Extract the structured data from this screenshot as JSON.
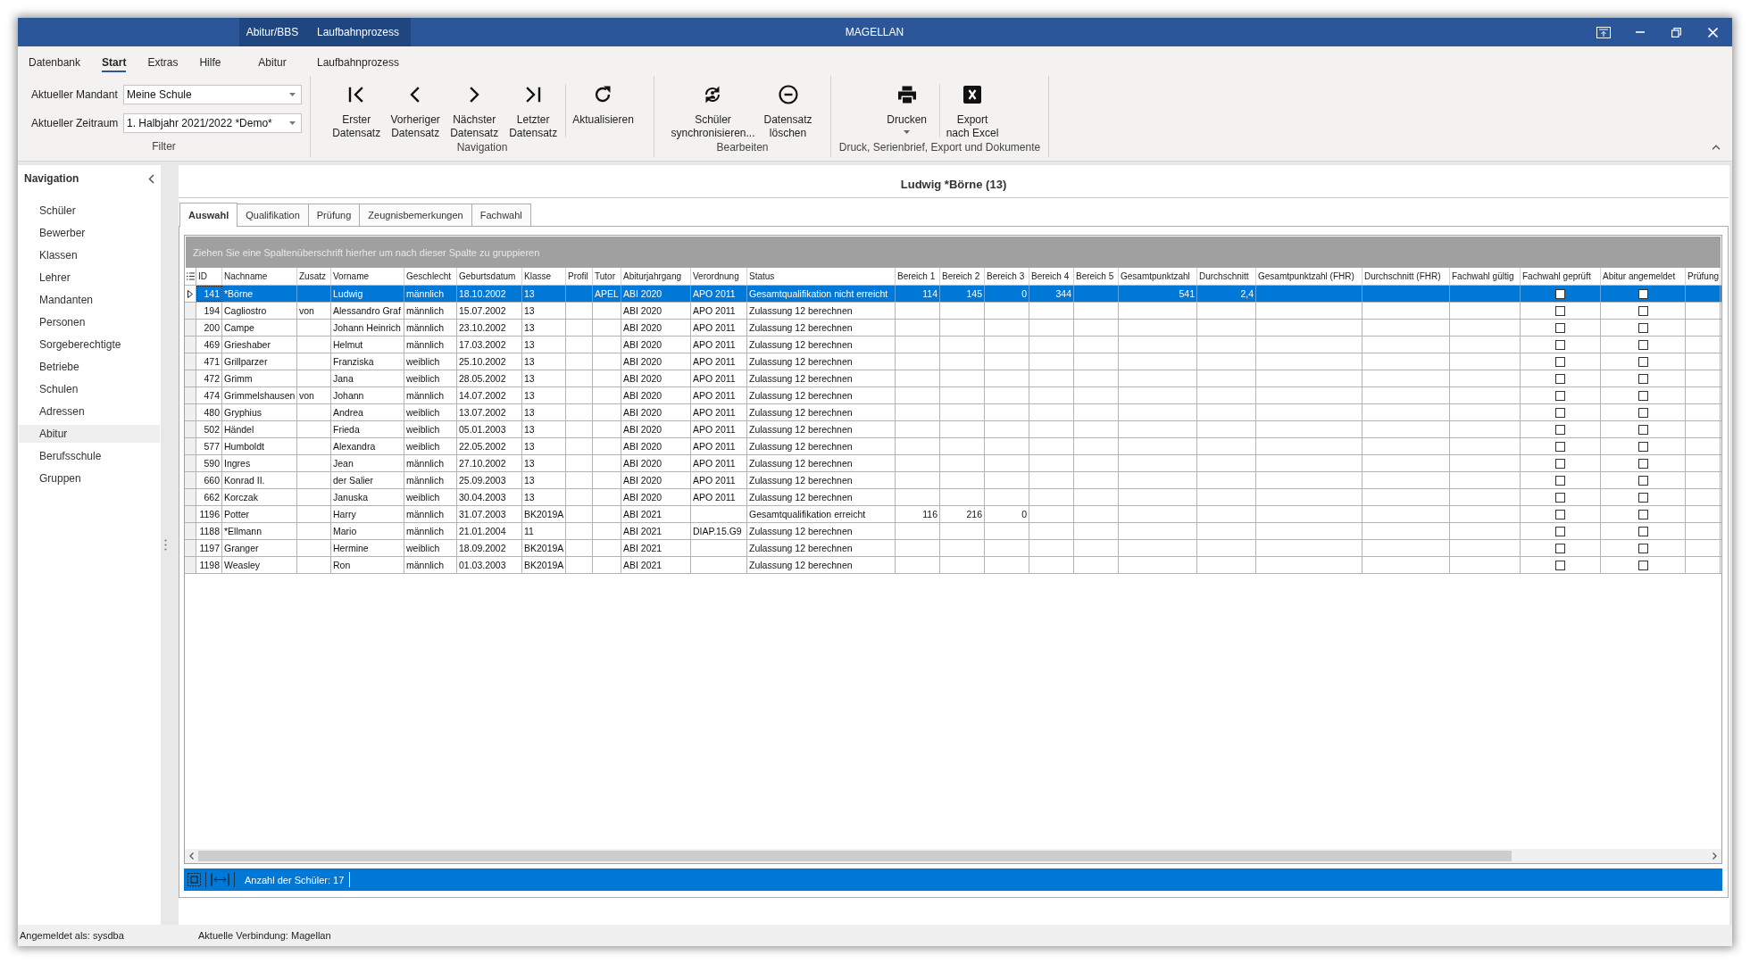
{
  "window": {
    "title": "MAGELLAN"
  },
  "ribbon_tabs": [
    {
      "label": "Datenbank",
      "selected": false
    },
    {
      "label": "Start",
      "selected": true
    },
    {
      "label": "Extras",
      "selected": false
    },
    {
      "label": "Hilfe",
      "selected": false
    }
  ],
  "context_tab_groups": [
    {
      "label": "Abitur/BBS",
      "tabs": [
        {
          "label": "Abitur",
          "selected": false
        }
      ]
    },
    {
      "label": "Laufbahnprozess",
      "tabs": [
        {
          "label": "Laufbahnprozess",
          "selected": false
        }
      ]
    }
  ],
  "ribbon": {
    "filter": {
      "label": "Filter",
      "fields": [
        {
          "label": "Aktueller Mandant",
          "value": "Meine Schule"
        },
        {
          "label": "Aktueller Zeitraum",
          "value": "1. Halbjahr 2021/2022 *Demo*"
        }
      ]
    },
    "groups": [
      {
        "label": "Navigation",
        "sets": [
          [
            {
              "label": "Erster\nDatensatz"
            },
            {
              "label": "Vorheriger\nDatensatz"
            },
            {
              "label": "Nächster\nDatensatz"
            },
            {
              "label": "Letzter\nDatensatz"
            }
          ],
          [
            {
              "label": "Aktualisieren"
            }
          ]
        ]
      },
      {
        "label": "Bearbeiten",
        "sets": [
          [
            {
              "label": "Schüler\nsynchronisieren..."
            },
            {
              "label": "Datensatz\nlöschen"
            }
          ]
        ]
      },
      {
        "label": "Druck, Serienbrief, Export und Dokumente",
        "sets": [
          [
            {
              "label": "Drucken",
              "dropdown": true
            }
          ],
          [
            {
              "label": "Export\nnach Excel"
            }
          ]
        ]
      }
    ]
  },
  "sidebar": {
    "title": "Navigation",
    "items": [
      {
        "label": "Schüler",
        "selected": false
      },
      {
        "label": "Bewerber",
        "selected": false
      },
      {
        "label": "Klassen",
        "selected": false
      },
      {
        "label": "Lehrer",
        "selected": false
      },
      {
        "label": "Mandanten",
        "selected": false
      },
      {
        "label": "Personen",
        "selected": false
      },
      {
        "label": "Sorgeberechtigte",
        "selected": false
      },
      {
        "label": "Betriebe",
        "selected": false
      },
      {
        "label": "Schulen",
        "selected": false
      },
      {
        "label": "Adressen",
        "selected": false
      },
      {
        "label": "Abitur",
        "selected": true
      },
      {
        "label": "Berufsschule",
        "selected": false
      },
      {
        "label": "Gruppen",
        "selected": false
      }
    ]
  },
  "record_title": "Ludwig *Börne (13)",
  "detail_tabs": [
    {
      "label": "Auswahl",
      "selected": true
    },
    {
      "label": "Qualifikation",
      "selected": false
    },
    {
      "label": "Prüfung",
      "selected": false
    },
    {
      "label": "Zeugnisbemerkungen",
      "selected": false
    },
    {
      "label": "Fachwahl",
      "selected": false
    }
  ],
  "grid": {
    "group_panel_hint": "Ziehen Sie eine Spaltenüberschrift hierher um nach dieser Spalte zu gruppieren",
    "columns": [
      {
        "label": "ID",
        "kind": "number"
      },
      {
        "label": "Nachname",
        "kind": "text"
      },
      {
        "label": "Zusatz",
        "kind": "text"
      },
      {
        "label": "Vorname",
        "kind": "text"
      },
      {
        "label": "Geschlecht",
        "kind": "text"
      },
      {
        "label": "Geburtsdatum",
        "kind": "text"
      },
      {
        "label": "Klasse",
        "kind": "text"
      },
      {
        "label": "Profil",
        "kind": "text"
      },
      {
        "label": "Tutor",
        "kind": "text"
      },
      {
        "label": "Abiturjahrgang",
        "kind": "text"
      },
      {
        "label": "Verordnung",
        "kind": "text"
      },
      {
        "label": "Status",
        "kind": "text"
      },
      {
        "label": "Bereich 1",
        "kind": "number"
      },
      {
        "label": "Bereich 2",
        "kind": "number"
      },
      {
        "label": "Bereich 3",
        "kind": "number"
      },
      {
        "label": "Bereich 4",
        "kind": "number"
      },
      {
        "label": "Bereich 5",
        "kind": "number"
      },
      {
        "label": "Gesamtpunktzahl",
        "kind": "number"
      },
      {
        "label": "Durchschnitt",
        "kind": "number"
      },
      {
        "label": "Gesamtpunktzahl (FHR)",
        "kind": "number"
      },
      {
        "label": "Durchschnitt (FHR)",
        "kind": "number"
      },
      {
        "label": "Fachwahl gültig",
        "kind": "text"
      },
      {
        "label": "Fachwahl geprüft",
        "kind": "checkbox"
      },
      {
        "label": "Abitur angemeldet",
        "kind": "checkbox"
      },
      {
        "label": "Prüfung",
        "kind": "text"
      }
    ],
    "rows": [
      {
        "selected": true,
        "cells": [
          "141",
          "*Börne",
          null,
          "Ludwig",
          "männlich",
          "18.10.2002",
          "13",
          null,
          "APEL",
          "ABI 2020",
          "APO 2011",
          "Gesamtqualifikation nicht erreicht",
          "114",
          "145",
          "0",
          "344",
          null,
          "541",
          "2,4",
          null,
          null,
          null,
          {
            "checked": false
          },
          {
            "checked": false
          },
          null
        ]
      },
      {
        "selected": false,
        "cells": [
          "194",
          "Cagliostro",
          "von",
          "Alessandro Graf",
          "männlich",
          "15.07.2002",
          "13",
          null,
          null,
          "ABI 2020",
          "APO 2011",
          "Zulassung 12 berechnen",
          null,
          null,
          null,
          null,
          null,
          null,
          null,
          null,
          null,
          null,
          {
            "checked": false
          },
          {
            "checked": false
          },
          null
        ]
      },
      {
        "selected": false,
        "cells": [
          "200",
          "Campe",
          null,
          "Johann Heinrich",
          "männlich",
          "23.10.2002",
          "13",
          null,
          null,
          "ABI 2020",
          "APO 2011",
          "Zulassung 12 berechnen",
          null,
          null,
          null,
          null,
          null,
          null,
          null,
          null,
          null,
          null,
          {
            "checked": false
          },
          {
            "checked": false
          },
          null
        ]
      },
      {
        "selected": false,
        "cells": [
          "469",
          "Grieshaber",
          null,
          "Helmut",
          "männlich",
          "17.03.2002",
          "13",
          null,
          null,
          "ABI 2020",
          "APO 2011",
          "Zulassung 12 berechnen",
          null,
          null,
          null,
          null,
          null,
          null,
          null,
          null,
          null,
          null,
          {
            "checked": false
          },
          {
            "checked": false
          },
          null
        ]
      },
      {
        "selected": false,
        "cells": [
          "471",
          "Grillparzer",
          null,
          "Franziska",
          "weiblich",
          "25.10.2002",
          "13",
          null,
          null,
          "ABI 2020",
          "APO 2011",
          "Zulassung 12 berechnen",
          null,
          null,
          null,
          null,
          null,
          null,
          null,
          null,
          null,
          null,
          {
            "checked": false
          },
          {
            "checked": false
          },
          null
        ]
      },
      {
        "selected": false,
        "cells": [
          "472",
          "Grimm",
          null,
          "Jana",
          "weiblich",
          "28.05.2002",
          "13",
          null,
          null,
          "ABI 2020",
          "APO 2011",
          "Zulassung 12 berechnen",
          null,
          null,
          null,
          null,
          null,
          null,
          null,
          null,
          null,
          null,
          {
            "checked": false
          },
          {
            "checked": false
          },
          null
        ]
      },
      {
        "selected": false,
        "cells": [
          "474",
          "Grimmelshausen",
          "von",
          "Johann",
          "männlich",
          "14.07.2002",
          "13",
          null,
          null,
          "ABI 2020",
          "APO 2011",
          "Zulassung 12 berechnen",
          null,
          null,
          null,
          null,
          null,
          null,
          null,
          null,
          null,
          null,
          {
            "checked": false
          },
          {
            "checked": false
          },
          null
        ]
      },
      {
        "selected": false,
        "cells": [
          "480",
          "Gryphius",
          null,
          "Andrea",
          "weiblich",
          "13.07.2002",
          "13",
          null,
          null,
          "ABI 2020",
          "APO 2011",
          "Zulassung 12 berechnen",
          null,
          null,
          null,
          null,
          null,
          null,
          null,
          null,
          null,
          null,
          {
            "checked": false
          },
          {
            "checked": false
          },
          null
        ]
      },
      {
        "selected": false,
        "cells": [
          "502",
          "Händel",
          null,
          "Frieda",
          "weiblich",
          "05.01.2003",
          "13",
          null,
          null,
          "ABI 2020",
          "APO 2011",
          "Zulassung 12 berechnen",
          null,
          null,
          null,
          null,
          null,
          null,
          null,
          null,
          null,
          null,
          {
            "checked": false
          },
          {
            "checked": false
          },
          null
        ]
      },
      {
        "selected": false,
        "cells": [
          "577",
          "Humboldt",
          null,
          "Alexandra",
          "weiblich",
          "22.05.2002",
          "13",
          null,
          null,
          "ABI 2020",
          "APO 2011",
          "Zulassung 12 berechnen",
          null,
          null,
          null,
          null,
          null,
          null,
          null,
          null,
          null,
          null,
          {
            "checked": false
          },
          {
            "checked": false
          },
          null
        ]
      },
      {
        "selected": false,
        "cells": [
          "590",
          "Ingres",
          null,
          "Jean",
          "männlich",
          "27.10.2002",
          "13",
          null,
          null,
          "ABI 2020",
          "APO 2011",
          "Zulassung 12 berechnen",
          null,
          null,
          null,
          null,
          null,
          null,
          null,
          null,
          null,
          null,
          {
            "checked": false
          },
          {
            "checked": false
          },
          null
        ]
      },
      {
        "selected": false,
        "cells": [
          "660",
          "Konrad II.",
          null,
          "der Salier",
          "männlich",
          "25.09.2003",
          "13",
          null,
          null,
          "ABI 2020",
          "APO 2011",
          "Zulassung 12 berechnen",
          null,
          null,
          null,
          null,
          null,
          null,
          null,
          null,
          null,
          null,
          {
            "checked": false
          },
          {
            "checked": false
          },
          null
        ]
      },
      {
        "selected": false,
        "cells": [
          "662",
          "Korczak",
          null,
          "Januska",
          "weiblich",
          "30.04.2003",
          "13",
          null,
          null,
          "ABI 2020",
          "APO 2011",
          "Zulassung 12 berechnen",
          null,
          null,
          null,
          null,
          null,
          null,
          null,
          null,
          null,
          null,
          {
            "checked": false
          },
          {
            "checked": false
          },
          null
        ]
      },
      {
        "selected": false,
        "cells": [
          "1196",
          "Potter",
          null,
          "Harry",
          "männlich",
          "31.07.2003",
          "BK2019A",
          null,
          null,
          "ABI 2021",
          null,
          "Gesamtqualifikation erreicht",
          "116",
          "216",
          "0",
          null,
          null,
          null,
          null,
          null,
          null,
          null,
          {
            "checked": false
          },
          {
            "checked": false
          },
          null
        ]
      },
      {
        "selected": false,
        "cells": [
          "1188",
          "*Ellmann",
          null,
          "Mario",
          "männlich",
          "21.01.2004",
          "11",
          null,
          null,
          "ABI 2021",
          "DIAP.15.G9",
          "Zulassung 12 berechnen",
          null,
          null,
          null,
          null,
          null,
          null,
          null,
          null,
          null,
          null,
          {
            "checked": false
          },
          {
            "checked": false
          },
          null
        ]
      },
      {
        "selected": false,
        "cells": [
          "1197",
          "Granger",
          null,
          "Hermine",
          "weiblich",
          "18.09.2002",
          "BK2019A",
          null,
          null,
          "ABI 2021",
          null,
          "Zulassung 12 berechnen",
          null,
          null,
          null,
          null,
          null,
          null,
          null,
          null,
          null,
          null,
          {
            "checked": false
          },
          {
            "checked": false
          },
          null
        ]
      },
      {
        "selected": false,
        "cells": [
          "1198",
          "Weasley",
          null,
          "Ron",
          "männlich",
          "01.03.2003",
          "BK2019A",
          null,
          null,
          "ABI 2021",
          null,
          "Zulassung 12 berechnen",
          null,
          null,
          null,
          null,
          null,
          null,
          null,
          null,
          null,
          null,
          {
            "checked": false
          },
          {
            "checked": false
          },
          null
        ]
      }
    ],
    "footer": {
      "record_count": "Anzahl der Schüler: 17"
    }
  },
  "status_bar": {
    "items": [
      "Angemeldet als: sysdba",
      "Aktuelle Verbindung: Magellan"
    ]
  }
}
